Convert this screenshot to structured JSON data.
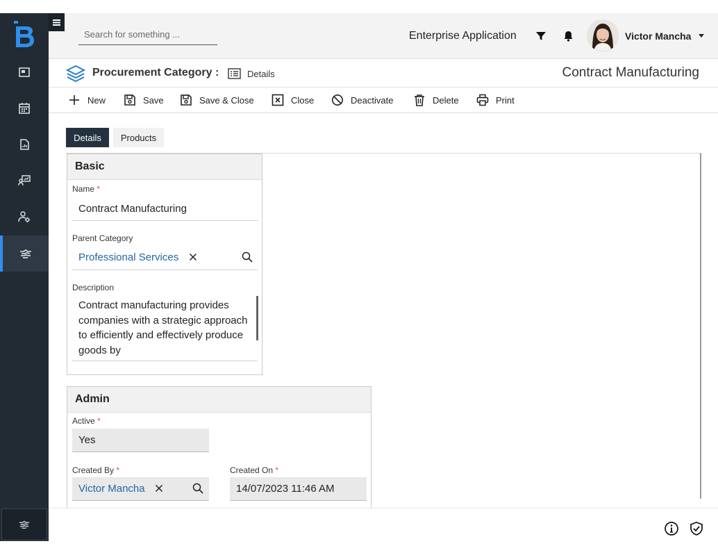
{
  "header": {
    "search_placeholder": "Search for something ...",
    "app_name": "Enterprise Application",
    "user_name": "Victor Mancha"
  },
  "breadcrumb": {
    "title": "Procurement Category :",
    "view": "Details",
    "record_title": "Contract Manufacturing"
  },
  "toolbar": {
    "new": "New",
    "save": "Save",
    "save_close": "Save & Close",
    "close": "Close",
    "deactivate": "Deactivate",
    "delete": "Delete",
    "print": "Print"
  },
  "tabs": [
    {
      "label": "Details",
      "active": true
    },
    {
      "label": "Products",
      "active": false
    }
  ],
  "basic": {
    "title": "Basic",
    "name_label": "Name",
    "name_value": "Contract Manufacturing",
    "parent_label": "Parent Category",
    "parent_value": "Professional Services",
    "description_label": "Description",
    "description_value": "Contract manufacturing provides companies with a strategic approach to efficiently and effectively produce goods by"
  },
  "admin": {
    "title": "Admin",
    "active_label": "Active",
    "active_value": "Yes",
    "created_by_label": "Created By",
    "created_by_value": "Victor Mancha",
    "created_on_label": "Created On",
    "created_on_value": "14/07/2023 11:46 AM"
  },
  "required_marker": "*",
  "colors": {
    "sidebar": "#222a33",
    "accent": "#2f8fea",
    "link": "#2266a6",
    "tab_active": "#243240"
  }
}
